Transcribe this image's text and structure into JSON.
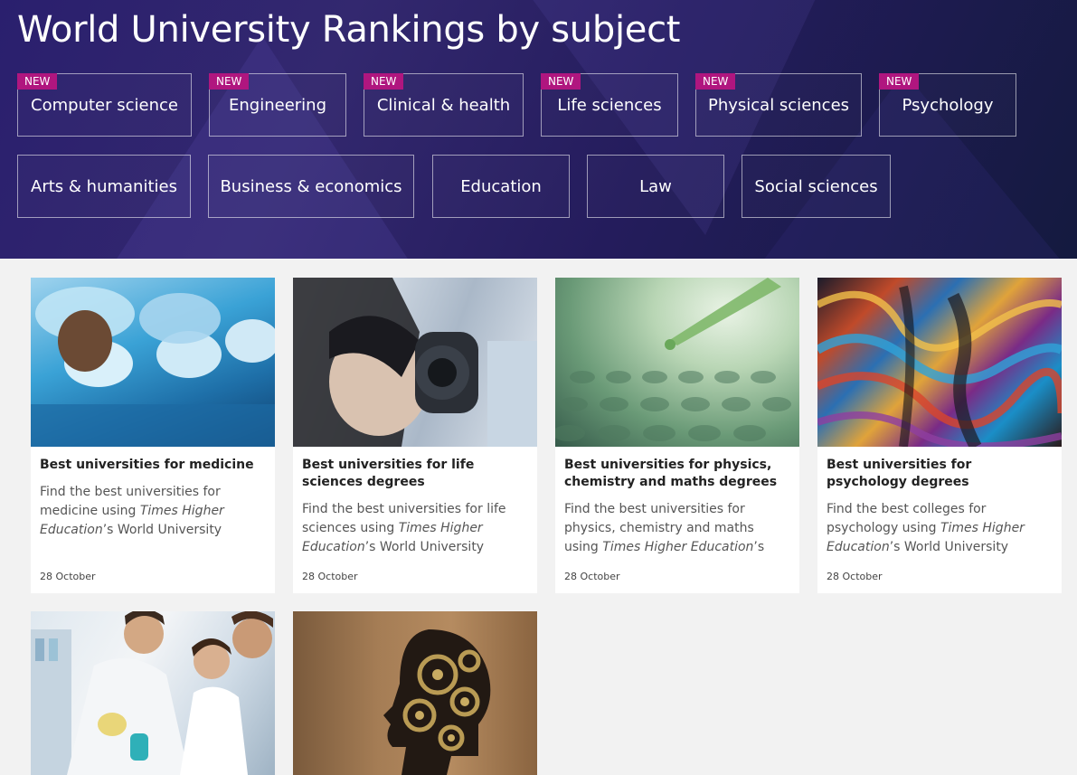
{
  "hero": {
    "title": "World University Rankings by subject",
    "new_badge": "NEW",
    "subjects_row1": [
      {
        "label": "Computer science",
        "badge": "NEW"
      },
      {
        "label": "Engineering",
        "badge": "NEW"
      },
      {
        "label": "Clinical & health",
        "badge": "NEW"
      },
      {
        "label": "Life sciences",
        "badge": "NEW"
      },
      {
        "label": "Physical sciences",
        "badge": "NEW"
      },
      {
        "label": "Psychology",
        "badge": "NEW"
      }
    ],
    "subjects_row2": [
      {
        "label": "Arts & humanities"
      },
      {
        "label": "Business & economics"
      },
      {
        "label": "Education"
      },
      {
        "label": "Law"
      },
      {
        "label": "Social sciences"
      }
    ]
  },
  "colors": {
    "badge": "#b0167f",
    "hero_bg": "#2a1f6e",
    "page_bg": "#f2f2f2"
  },
  "cards": [
    {
      "title": "Best universities for medicine",
      "desc_pre": "Find the best universities for medicine using ",
      "desc_em": "Times Higher Education",
      "desc_post": "’s World University Rankings data",
      "date": "28 October",
      "image": "surgeons-photo"
    },
    {
      "title": "Best universities for life sciences degrees",
      "desc_pre": "Find the best universities for life sciences using ",
      "desc_em": "Times Higher Education",
      "desc_post": "’s World University Ranking…",
      "date": "28 October",
      "image": "microscope-photo"
    },
    {
      "title": "Best universities for physics, chemistry and maths degrees",
      "desc_pre": "Find the best universities for physics, chemistry and maths using ",
      "desc_em": "Times Higher Education",
      "desc_post": "’s World University…",
      "date": "28 October",
      "image": "pipette-photo"
    },
    {
      "title": "Best universities for psychology degrees",
      "desc_pre": "Find the best colleges for psychology using ",
      "desc_em": "Times Higher Education",
      "desc_post": "’s World University Rankings data",
      "date": "28 October",
      "image": "abstract-faces-photo"
    },
    {
      "image": "lab-scientists-photo"
    },
    {
      "image": "gear-head-photo"
    }
  ]
}
